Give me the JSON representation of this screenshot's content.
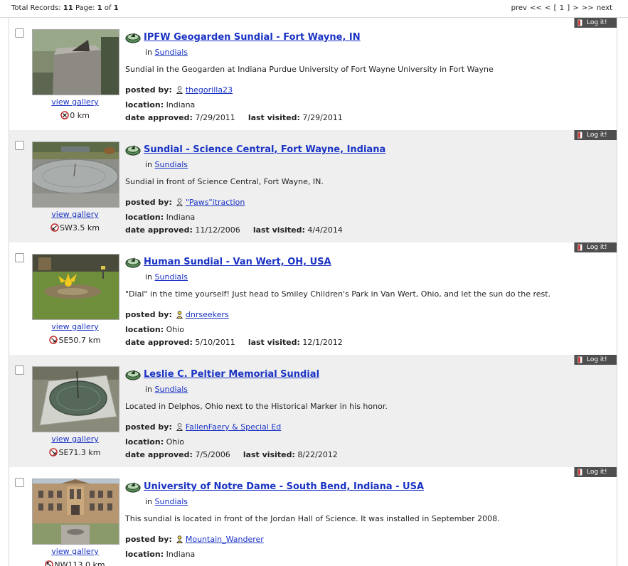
{
  "header": {
    "total_label": "Total Records:",
    "total": "11",
    "page_label": "Page:",
    "page": "1",
    "of_label": "of",
    "pages": "1",
    "prev": "prev <<",
    "current": "< [ 1 ] >",
    "next": ">> next"
  },
  "labels": {
    "in": "in",
    "posted_by": "posted by:",
    "location": "location:",
    "date_approved": "date approved:",
    "last_visited": "last visited:",
    "view_gallery": "view gallery",
    "log_it": "Log it!"
  },
  "icons": {
    "type": "sundial-icon",
    "user": "user-icon",
    "distance_origin": "origin-x-icon",
    "distance_direction": "compass-arrow-icon",
    "log": "log-book-icon"
  },
  "records": [
    {
      "title": "IPFW Geogarden Sundial - Fort Wayne, IN",
      "category": "Sundials",
      "description": "Sundial in the Geogarden at Indiana Purdue University of Fort Wayne University in Fort Wayne",
      "posted_by": "thegorilla23",
      "location": "Indiana",
      "date_approved": "7/29/2011",
      "last_visited": "7/29/2011",
      "distance": "0 km",
      "image": "gnomon sundial on stone pillar"
    },
    {
      "title": "Sundial - Science Central, Fort Wayne, Indiana",
      "category": "Sundials",
      "description": "Sundial in front of Science Central, Fort Wayne, IN.",
      "posted_by": "\"Paws\"itraction",
      "location": "Indiana",
      "date_approved": "11/12/2006",
      "last_visited": "4/4/2014",
      "distance": "SW3.5 km",
      "image": "round stone sundial plaza"
    },
    {
      "title": "Human Sundial - Van Wert, OH, USA",
      "category": "Sundials",
      "description": "\"Dial\" in the time yourself! Just head to Smiley Children's Park in Van Wert, Ohio, and let the sun do the rest.",
      "posted_by": "dnrseekers",
      "location": "Ohio",
      "date_approved": "5/10/2011",
      "last_visited": "12/1/2012",
      "distance": "SE50.7 km",
      "image": "sun sculpture on lawn"
    },
    {
      "title": "Leslie C. Peltier Memorial Sundial",
      "category": "Sundials",
      "description": "Located in Delphos, Ohio next to the Historical Marker in his honor.",
      "posted_by": "FallenFaery & Special Ed",
      "location": "Ohio",
      "date_approved": "7/5/2006",
      "last_visited": "8/22/2012",
      "distance": "SE71.3 km",
      "image": "bronze sundial on marble base"
    },
    {
      "title": "University of Notre Dame - South Bend, Indiana - USA",
      "category": "Sundials",
      "description": "This sundial is located in front of the Jordan Hall of Science. It was installed in September 2008.",
      "posted_by": "Mountain_Wanderer",
      "location": "Indiana",
      "date_approved": "",
      "last_visited": "",
      "distance": "NW113.0 km",
      "image": "university building facade"
    }
  ]
}
